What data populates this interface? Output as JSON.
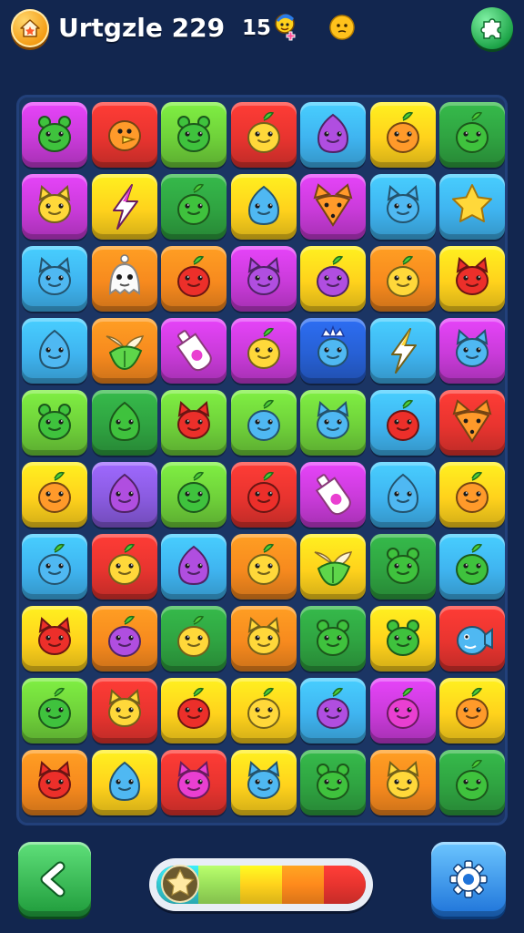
{
  "header": {
    "title": "Urtgzle 229",
    "moves": "15"
  },
  "colors": {
    "background": "#12264f",
    "board": "#1b3564",
    "tile_palette": {
      "magenta": "#c93bd9",
      "red": "#e8342f",
      "lime": "#6fd13a",
      "yellow": "#ffd21c",
      "sky": "#3fb4f0",
      "green": "#2fa341",
      "orange": "#f78a1e",
      "blue": "#2760d4",
      "purple": "#8a5be0"
    }
  },
  "board": {
    "rows": 10,
    "cols": 7,
    "tiles": [
      [
        {
          "bg": "magenta",
          "face": "green",
          "icon": "frog"
        },
        {
          "bg": "red",
          "face": "orange",
          "icon": "bird"
        },
        {
          "bg": "lime",
          "face": "green",
          "icon": "frog"
        },
        {
          "bg": "red",
          "face": "yellow",
          "icon": "fruit"
        },
        {
          "bg": "sky",
          "face": "purple",
          "icon": "blob"
        },
        {
          "bg": "yellow",
          "face": "orange",
          "icon": "fruit"
        },
        {
          "bg": "green",
          "face": "green",
          "icon": "fruit"
        }
      ],
      [
        {
          "bg": "magenta",
          "face": "yellow",
          "icon": "cat"
        },
        {
          "bg": "yellow",
          "face": "magenta",
          "icon": "bolt"
        },
        {
          "bg": "green",
          "face": "green",
          "icon": "fruit"
        },
        {
          "bg": "yellow",
          "face": "sky",
          "icon": "blob"
        },
        {
          "bg": "magenta",
          "face": "orange",
          "icon": "fox"
        },
        {
          "bg": "sky",
          "face": "sky",
          "icon": "cat"
        },
        {
          "bg": "sky",
          "face": "yellow",
          "icon": "star"
        }
      ],
      [
        {
          "bg": "sky",
          "face": "sky",
          "icon": "cat"
        },
        {
          "bg": "orange",
          "face": "white",
          "icon": "ghost"
        },
        {
          "bg": "orange",
          "face": "red",
          "icon": "fruit"
        },
        {
          "bg": "magenta",
          "face": "purple",
          "icon": "cat"
        },
        {
          "bg": "yellow",
          "face": "purple",
          "icon": "fruit"
        },
        {
          "bg": "orange",
          "face": "yellow",
          "icon": "fruit"
        },
        {
          "bg": "yellow",
          "face": "red",
          "icon": "cat"
        }
      ],
      [
        {
          "bg": "sky",
          "face": "sky",
          "icon": "blob"
        },
        {
          "bg": "orange",
          "face": "green",
          "icon": "leaf"
        },
        {
          "bg": "magenta",
          "face": "white",
          "icon": "potion"
        },
        {
          "bg": "magenta",
          "face": "yellow",
          "icon": "fruit"
        },
        {
          "bg": "blue",
          "face": "sky",
          "icon": "crown"
        },
        {
          "bg": "sky",
          "face": "yellow",
          "icon": "bolt"
        },
        {
          "bg": "magenta",
          "face": "sky",
          "icon": "cat"
        }
      ],
      [
        {
          "bg": "lime",
          "face": "green",
          "icon": "frog"
        },
        {
          "bg": "green",
          "face": "green",
          "icon": "blob"
        },
        {
          "bg": "lime",
          "face": "red",
          "icon": "cat"
        },
        {
          "bg": "lime",
          "face": "sky",
          "icon": "fruit"
        },
        {
          "bg": "lime",
          "face": "sky",
          "icon": "cat"
        },
        {
          "bg": "sky",
          "face": "red",
          "icon": "fruit"
        },
        {
          "bg": "red",
          "face": "orange",
          "icon": "fox"
        }
      ],
      [
        {
          "bg": "yellow",
          "face": "orange",
          "icon": "fruit"
        },
        {
          "bg": "purple",
          "face": "purple",
          "icon": "blob"
        },
        {
          "bg": "lime",
          "face": "green",
          "icon": "fruit"
        },
        {
          "bg": "red",
          "face": "red",
          "icon": "fruit"
        },
        {
          "bg": "magenta",
          "face": "white",
          "icon": "potion"
        },
        {
          "bg": "sky",
          "face": "sky",
          "icon": "blob"
        },
        {
          "bg": "yellow",
          "face": "orange",
          "icon": "fruit"
        }
      ],
      [
        {
          "bg": "sky",
          "face": "sky",
          "icon": "fruit"
        },
        {
          "bg": "red",
          "face": "yellow",
          "icon": "fruit"
        },
        {
          "bg": "sky",
          "face": "purple",
          "icon": "blob"
        },
        {
          "bg": "orange",
          "face": "yellow",
          "icon": "fruit"
        },
        {
          "bg": "yellow",
          "face": "green",
          "icon": "leaf"
        },
        {
          "bg": "green",
          "face": "green",
          "icon": "frog"
        },
        {
          "bg": "sky",
          "face": "green",
          "icon": "fruit"
        }
      ],
      [
        {
          "bg": "yellow",
          "face": "red",
          "icon": "cat"
        },
        {
          "bg": "orange",
          "face": "purple",
          "icon": "fruit"
        },
        {
          "bg": "green",
          "face": "yellow",
          "icon": "fruit"
        },
        {
          "bg": "orange",
          "face": "yellow",
          "icon": "cat"
        },
        {
          "bg": "green",
          "face": "green",
          "icon": "frog"
        },
        {
          "bg": "yellow",
          "face": "green",
          "icon": "frog"
        },
        {
          "bg": "red",
          "face": "sky",
          "icon": "fish"
        }
      ],
      [
        {
          "bg": "lime",
          "face": "green",
          "icon": "fruit"
        },
        {
          "bg": "red",
          "face": "yellow",
          "icon": "cat"
        },
        {
          "bg": "yellow",
          "face": "red",
          "icon": "fruit"
        },
        {
          "bg": "yellow",
          "face": "yellow",
          "icon": "fruit"
        },
        {
          "bg": "sky",
          "face": "purple",
          "icon": "fruit"
        },
        {
          "bg": "magenta",
          "face": "magenta",
          "icon": "fruit"
        },
        {
          "bg": "yellow",
          "face": "orange",
          "icon": "fruit"
        }
      ],
      [
        {
          "bg": "orange",
          "face": "red",
          "icon": "cat"
        },
        {
          "bg": "yellow",
          "face": "sky",
          "icon": "blob"
        },
        {
          "bg": "red",
          "face": "magenta",
          "icon": "cat"
        },
        {
          "bg": "yellow",
          "face": "sky",
          "icon": "cat"
        },
        {
          "bg": "green",
          "face": "green",
          "icon": "frog"
        },
        {
          "bg": "orange",
          "face": "yellow",
          "icon": "cat"
        },
        {
          "bg": "green",
          "face": "green",
          "icon": "fruit"
        }
      ]
    ]
  },
  "footer": {
    "back_icon": "chevron-left-icon",
    "settings_icon": "gear-icon",
    "progress_icon": "star-icon",
    "progress_colors": [
      "#31c7d0",
      "#9be15b",
      "#ffd21c",
      "#ff8a1c",
      "#e8342f"
    ]
  }
}
